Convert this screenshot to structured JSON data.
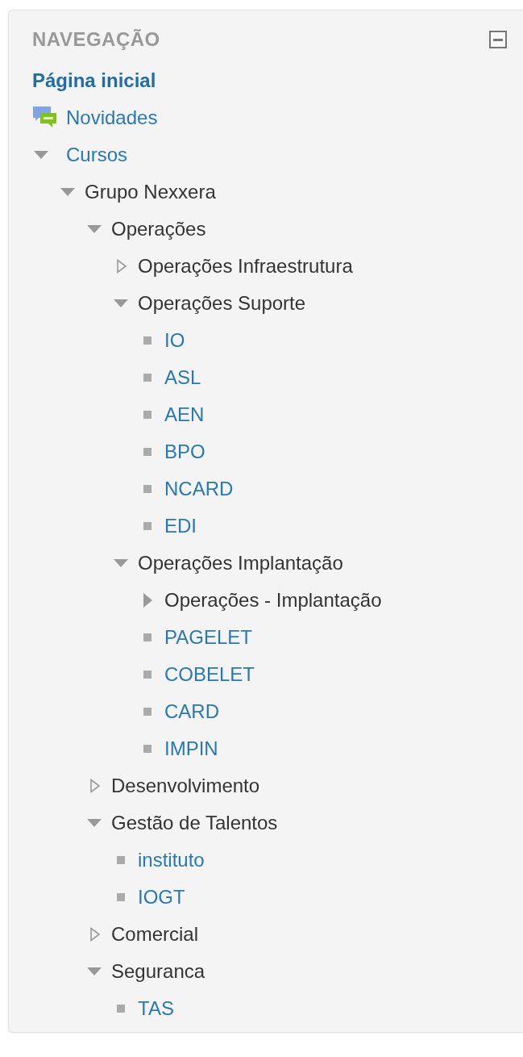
{
  "block": {
    "title": "NAVEGAÇÃO",
    "items": [
      {
        "kind": "home",
        "label": "Página inicial"
      },
      {
        "kind": "news",
        "label": "Novidades"
      },
      {
        "kind": "link-category",
        "label": "Cursos",
        "expanded": true,
        "children": [
          {
            "kind": "category",
            "label": "Grupo Nexxera",
            "expanded": true,
            "children": [
              {
                "kind": "category",
                "label": "Operações",
                "expanded": true,
                "children": [
                  {
                    "kind": "category",
                    "label": "Operações Infraestrutura",
                    "expanded": false
                  },
                  {
                    "kind": "category",
                    "label": "Operações Suporte",
                    "expanded": true,
                    "children": [
                      {
                        "kind": "course",
                        "label": "IO"
                      },
                      {
                        "kind": "course",
                        "label": "ASL"
                      },
                      {
                        "kind": "course",
                        "label": "AEN"
                      },
                      {
                        "kind": "course",
                        "label": "BPO"
                      },
                      {
                        "kind": "course",
                        "label": "NCARD"
                      },
                      {
                        "kind": "course",
                        "label": "EDI"
                      }
                    ]
                  },
                  {
                    "kind": "category",
                    "label": "Operações Implantação",
                    "expanded": true,
                    "children": [
                      {
                        "kind": "section",
                        "label": "Operações - Implantação",
                        "expanded": false
                      },
                      {
                        "kind": "course",
                        "label": "PAGELET"
                      },
                      {
                        "kind": "course",
                        "label": "COBELET"
                      },
                      {
                        "kind": "course",
                        "label": "CARD"
                      },
                      {
                        "kind": "course",
                        "label": "IMPIN"
                      }
                    ]
                  }
                ]
              },
              {
                "kind": "category",
                "label": "Desenvolvimento",
                "expanded": false
              },
              {
                "kind": "category",
                "label": "Gestão de Talentos",
                "expanded": true,
                "children": [
                  {
                    "kind": "course",
                    "label": "instituto"
                  },
                  {
                    "kind": "course",
                    "label": "IOGT"
                  }
                ]
              },
              {
                "kind": "category",
                "label": "Comercial",
                "expanded": false
              },
              {
                "kind": "category",
                "label": "Seguranca",
                "expanded": true,
                "children": [
                  {
                    "kind": "course",
                    "label": "TAS"
                  }
                ]
              }
            ]
          }
        ]
      }
    ]
  }
}
